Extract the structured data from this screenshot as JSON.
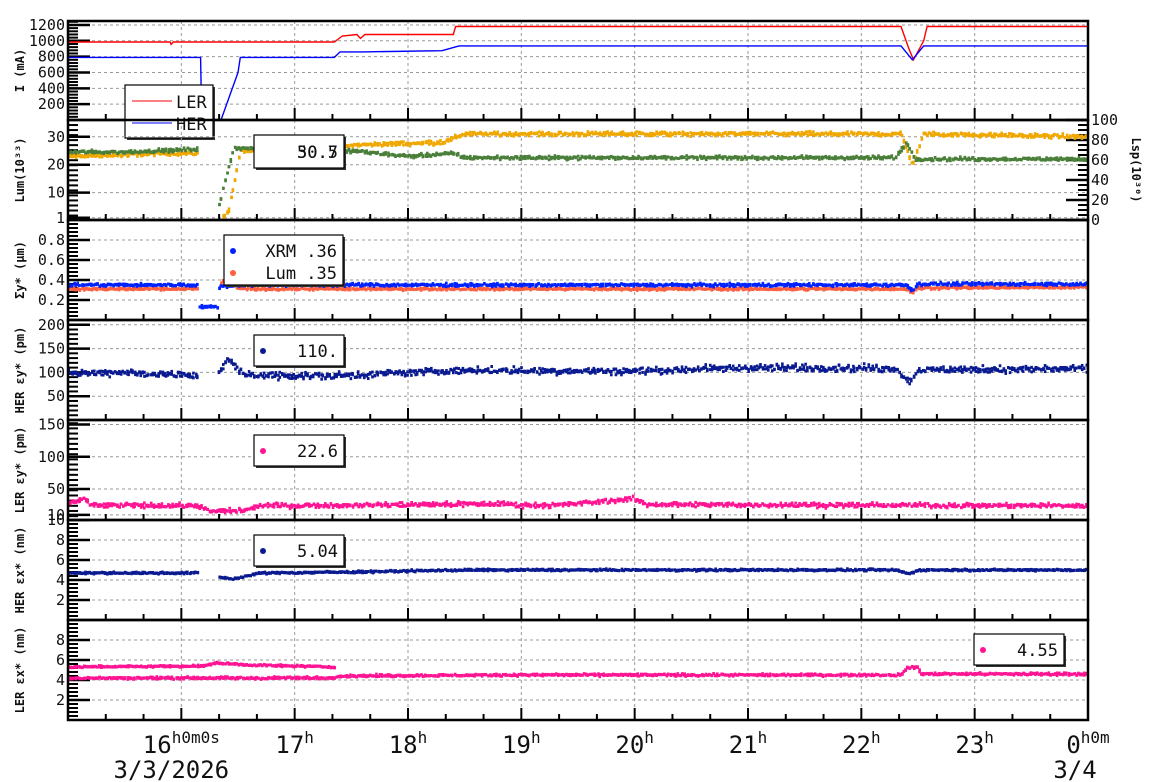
{
  "chart_data": {
    "type": "scatter",
    "x_axis": {
      "range_hours": [
        15,
        24
      ],
      "tick_labels": [
        {
          "t": 16,
          "main": "16",
          "sup": "h0m0s"
        },
        {
          "t": 17,
          "main": "17",
          "sup": "h"
        },
        {
          "t": 18,
          "main": "18",
          "sup": "h"
        },
        {
          "t": 19,
          "main": "19",
          "sup": "h"
        },
        {
          "t": 20,
          "main": "20",
          "sup": "h"
        },
        {
          "t": 21,
          "main": "21",
          "sup": "h"
        },
        {
          "t": 22,
          "main": "22",
          "sup": "h"
        },
        {
          "t": 23,
          "main": "23",
          "sup": "h"
        },
        {
          "t": 24,
          "main": "0",
          "sup": "h0m"
        }
      ],
      "date_labels": [
        {
          "t": 16,
          "text": "3/3/2026"
        },
        {
          "t": 24,
          "text": "3/4"
        }
      ],
      "grid": true
    },
    "panels": [
      {
        "ylabel": "I (mA)",
        "ylim": [
          0,
          1250
        ],
        "yticks": [
          200,
          400,
          600,
          800,
          1000,
          1200
        ],
        "legend": [
          {
            "label": "LER",
            "color": "#ff0000",
            "kind": "line"
          },
          {
            "label": "HER",
            "color": "#0000ff",
            "kind": "line"
          }
        ],
        "series": [
          {
            "name": "LER",
            "color": "#ff0000",
            "kind": "line",
            "noise": 0,
            "points": [
              [
                15,
                985
              ],
              [
                15.9,
                985
              ],
              [
                15.91,
                955
              ],
              [
                15.93,
                985
              ],
              [
                17.35,
                985
              ],
              [
                17.42,
                1060
              ],
              [
                17.55,
                1080
              ],
              [
                17.58,
                1030
              ],
              [
                17.62,
                1080
              ],
              [
                18.4,
                1080
              ],
              [
                18.42,
                1180
              ],
              [
                22.35,
                1180
              ],
              [
                22.42,
                900
              ],
              [
                22.46,
                760
              ],
              [
                22.55,
                1000
              ],
              [
                22.58,
                1180
              ],
              [
                24,
                1180
              ]
            ]
          },
          {
            "name": "HER",
            "color": "#0000ff",
            "kind": "line",
            "noise": 0,
            "points": [
              [
                15,
                790
              ],
              [
                16.17,
                790
              ],
              [
                16.18,
                0
              ],
              [
                16.35,
                0
              ],
              [
                16.5,
                600
              ],
              [
                16.52,
                790
              ],
              [
                17.35,
                790
              ],
              [
                17.4,
                860
              ],
              [
                17.6,
                860
              ],
              [
                18.3,
                875
              ],
              [
                18.45,
                935
              ],
              [
                22.35,
                935
              ],
              [
                22.45,
                760
              ],
              [
                22.55,
                935
              ],
              [
                24,
                935
              ]
            ]
          }
        ]
      },
      {
        "ylabel": "Lum(10³³)",
        "ylim": [
          0.2,
          36
        ],
        "yticks": [
          1,
          10,
          20,
          30
        ],
        "right_axis": {
          "label": "Lsp(10³⁰)",
          "ylim": [
            0,
            100
          ],
          "yticks": [
            0,
            20,
            40,
            60,
            80,
            100
          ]
        },
        "legend": [
          {
            "label": "30.5",
            "color": "#111111",
            "kind": "text"
          },
          {
            "label": "50.7",
            "color": "#111111",
            "kind": "text"
          }
        ],
        "series": [
          {
            "name": "Lsp",
            "color": "#f0a800",
            "kind": "dots",
            "noise": 0.6,
            "points": [
              [
                15,
                23
              ],
              [
                15.5,
                23.5
              ],
              [
                15.8,
                24
              ],
              [
                16.15,
                24
              ],
              [
                16.16,
                null
              ],
              [
                16.36,
                1
              ],
              [
                16.42,
                4
              ],
              [
                16.52,
                25
              ],
              [
                17.3,
                24
              ],
              [
                17.5,
                27
              ],
              [
                18.3,
                28
              ],
              [
                18.5,
                31
              ],
              [
                22.35,
                31
              ],
              [
                22.45,
                20
              ],
              [
                22.55,
                31
              ],
              [
                24,
                30
              ]
            ]
          },
          {
            "name": "Lum",
            "color": "#4a7f3a",
            "kind": "dots",
            "noise": 0.5,
            "points": [
              [
                15,
                24.5
              ],
              [
                15.5,
                24.5
              ],
              [
                15.8,
                25
              ],
              [
                16.15,
                25.5
              ],
              [
                16.16,
                null
              ],
              [
                16.32,
                3
              ],
              [
                16.36,
                10
              ],
              [
                16.46,
                26
              ],
              [
                17,
                25.5
              ],
              [
                17.3,
                24
              ],
              [
                17.5,
                25
              ],
              [
                18,
                23
              ],
              [
                18.4,
                24
              ],
              [
                18.5,
                22.5
              ],
              [
                22.3,
                22.5
              ],
              [
                22.4,
                28
              ],
              [
                22.47,
                22
              ],
              [
                24,
                22
              ]
            ]
          }
        ]
      },
      {
        "ylabel": "Σy* (μm)",
        "ylim": [
          0,
          1
        ],
        "yticks": [
          0.2,
          0.4,
          0.6,
          0.8
        ],
        "legend": [
          {
            "label": "XRM  .36",
            "color": "#0022ff",
            "kind": "dot"
          },
          {
            "label": "Lum  .35",
            "color": "#ff6040",
            "kind": "dot"
          }
        ],
        "series": [
          {
            "name": "Lum",
            "color": "#ff6040",
            "kind": "dots",
            "noise": 0.01,
            "points": [
              [
                15,
                0.31
              ],
              [
                16.15,
                0.31
              ],
              [
                16.16,
                null
              ],
              [
                16.35,
                0.36
              ],
              [
                16.4,
                0.45
              ],
              [
                16.5,
                0.31
              ],
              [
                22.4,
                0.31
              ],
              [
                22.45,
                0.27
              ],
              [
                22.5,
                0.32
              ],
              [
                24,
                0.33
              ]
            ]
          },
          {
            "name": "XRM",
            "color": "#0022ff",
            "kind": "dots",
            "noise": 0.012,
            "points": [
              [
                15,
                0.35
              ],
              [
                16.15,
                0.35
              ],
              [
                16.16,
                0.13
              ],
              [
                16.32,
                0.13
              ],
              [
                16.33,
                0.33
              ],
              [
                16.5,
                0.35
              ],
              [
                22.4,
                0.35
              ],
              [
                22.45,
                0.29
              ],
              [
                22.5,
                0.36
              ],
              [
                24,
                0.36
              ]
            ]
          }
        ]
      },
      {
        "ylabel": "HER εy* (pm)",
        "ylim": [
          0,
          210
        ],
        "yticks": [
          50,
          100,
          150,
          200
        ],
        "legend": [
          {
            "label": "110.",
            "color": "#0a1a90",
            "kind": "dot"
          }
        ],
        "series": [
          {
            "name": "HER emittance y",
            "color": "#0a1a90",
            "kind": "dots",
            "noise": 6,
            "points": [
              [
                15,
                98
              ],
              [
                15.5,
                100
              ],
              [
                16.15,
                92
              ],
              [
                16.16,
                null
              ],
              [
                16.32,
                95
              ],
              [
                16.4,
                130
              ],
              [
                16.55,
                95
              ],
              [
                17.3,
                92
              ],
              [
                18.4,
                104
              ],
              [
                20,
                103
              ],
              [
                21,
                110
              ],
              [
                22.3,
                108
              ],
              [
                22.42,
                80
              ],
              [
                22.5,
                105
              ],
              [
                24,
                108
              ]
            ]
          }
        ]
      },
      {
        "ylabel": "LER εy* (pm)",
        "ylim": [
          2,
          157
        ],
        "yticks": [
          10,
          50,
          100,
          150
        ],
        "legend": [
          {
            "label": "22.6",
            "color": "#ff1493",
            "kind": "dot"
          }
        ],
        "series": [
          {
            "name": "LER emittance y",
            "color": "#ff1493",
            "kind": "dots",
            "noise": 3,
            "points": [
              [
                15,
                28
              ],
              [
                15.15,
                35
              ],
              [
                15.2,
                25
              ],
              [
                16.15,
                24
              ],
              [
                16.25,
                15
              ],
              [
                16.55,
                17
              ],
              [
                16.7,
                24
              ],
              [
                18.9,
                27
              ],
              [
                18.91,
                25
              ],
              [
                19.35,
                25
              ],
              [
                19.4,
                26
              ],
              [
                20,
                35
              ],
              [
                20.1,
                26
              ],
              [
                24,
                24
              ]
            ]
          }
        ]
      },
      {
        "ylabel": "HER εx* (nm)",
        "ylim": [
          0,
          10
        ],
        "yticks": [
          2,
          4,
          6,
          8,
          10
        ],
        "legend": [
          {
            "label": "5.04",
            "color": "#0a1a90",
            "kind": "dot"
          }
        ],
        "series": [
          {
            "name": "HER emittance x",
            "color": "#0a1a90",
            "kind": "dots",
            "noise": 0.08,
            "points": [
              [
                15,
                4.7
              ],
              [
                16.15,
                4.7
              ],
              [
                16.16,
                null
              ],
              [
                16.33,
                4.3
              ],
              [
                16.45,
                4.1
              ],
              [
                16.7,
                4.7
              ],
              [
                17.5,
                4.8
              ],
              [
                18.5,
                5.0
              ],
              [
                22.3,
                5.0
              ],
              [
                22.42,
                4.6
              ],
              [
                22.5,
                5.0
              ],
              [
                24,
                5.0
              ]
            ]
          }
        ]
      },
      {
        "ylabel": "LER εx* (nm)",
        "ylim": [
          0,
          10
        ],
        "yticks": [
          2,
          4,
          6,
          8
        ],
        "legend": [
          {
            "label": "4.55",
            "color": "#ff1493",
            "kind": "dot"
          }
        ],
        "series": [
          {
            "name": "LER emittance x upper",
            "color": "#ff1493",
            "kind": "dots",
            "noise": 0.08,
            "points": [
              [
                15,
                5.3
              ],
              [
                16.2,
                5.4
              ],
              [
                16.3,
                5.7
              ],
              [
                16.6,
                5.5
              ],
              [
                17.35,
                5.3
              ],
              [
                17.36,
                null
              ],
              [
                24,
                null
              ]
            ]
          },
          {
            "name": "LER emittance x",
            "color": "#ff1493",
            "kind": "dots",
            "noise": 0.1,
            "points": [
              [
                15,
                4.2
              ],
              [
                17.35,
                4.2
              ],
              [
                17.36,
                4.4
              ],
              [
                18.9,
                4.5
              ],
              [
                19.35,
                4.5
              ],
              [
                22.35,
                4.5
              ],
              [
                22.4,
                5.2
              ],
              [
                22.5,
                5.3
              ],
              [
                22.52,
                4.6
              ],
              [
                24,
                4.6
              ]
            ]
          }
        ]
      }
    ]
  }
}
